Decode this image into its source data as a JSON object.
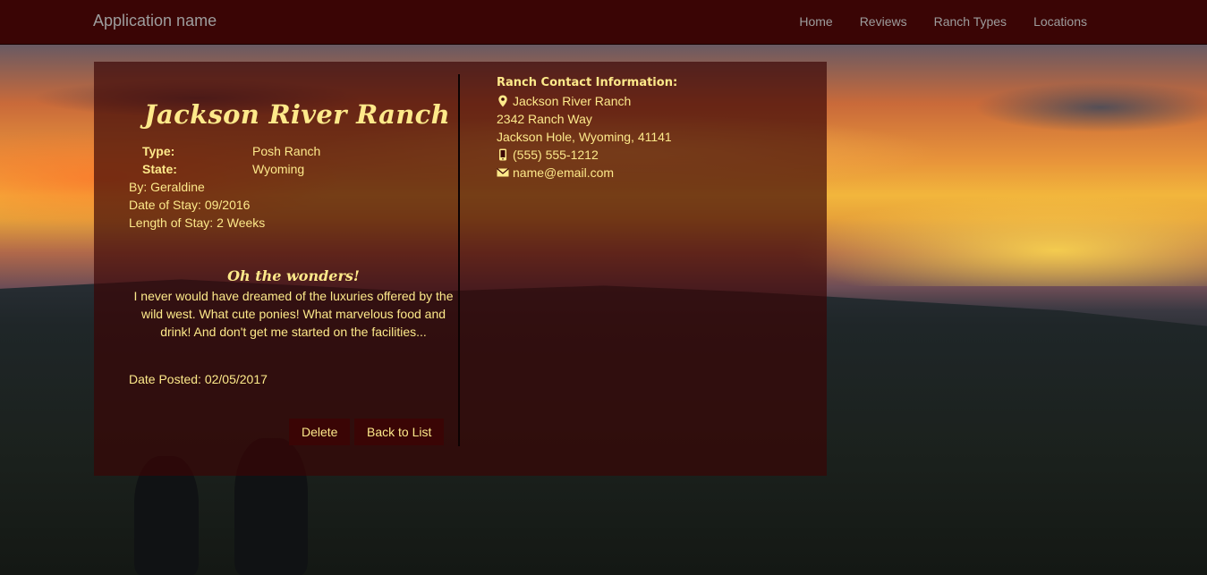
{
  "navbar": {
    "brand": "Application name",
    "links": [
      "Home",
      "Reviews",
      "Ranch Types",
      "Locations"
    ]
  },
  "review": {
    "ranch_name": "Jackson River Ranch",
    "type_label": "Type:",
    "type_value": "Posh Ranch",
    "state_label": "State:",
    "state_value": "Wyoming",
    "by": "By: Geraldine",
    "date_of_stay": "Date of Stay: 09/2016",
    "length_of_stay": "Length of Stay: 2 Weeks",
    "title": "Oh the wonders!",
    "body": "I never would have dreamed of the luxuries offered by the wild west. What cute ponies! What marvelous food and drink! And don't get me started on the facilities...",
    "date_posted": "Date Posted: 02/05/2017"
  },
  "buttons": {
    "delete": "Delete",
    "back": "Back to List"
  },
  "contact": {
    "heading": "Ranch Contact Information:",
    "name": "Jackson River Ranch",
    "address1": "2342 Ranch Way",
    "address2": "Jackson Hole, Wyoming, 41141",
    "phone": "(555) 555-1212",
    "email": "name@email.com"
  },
  "colors": {
    "navbar": "#3a0505",
    "text_accent": "#fde98a",
    "nav_text": "#9d9d9d"
  },
  "icons": {
    "location": "map-marker-icon",
    "phone": "phone-icon",
    "email": "envelope-icon"
  }
}
